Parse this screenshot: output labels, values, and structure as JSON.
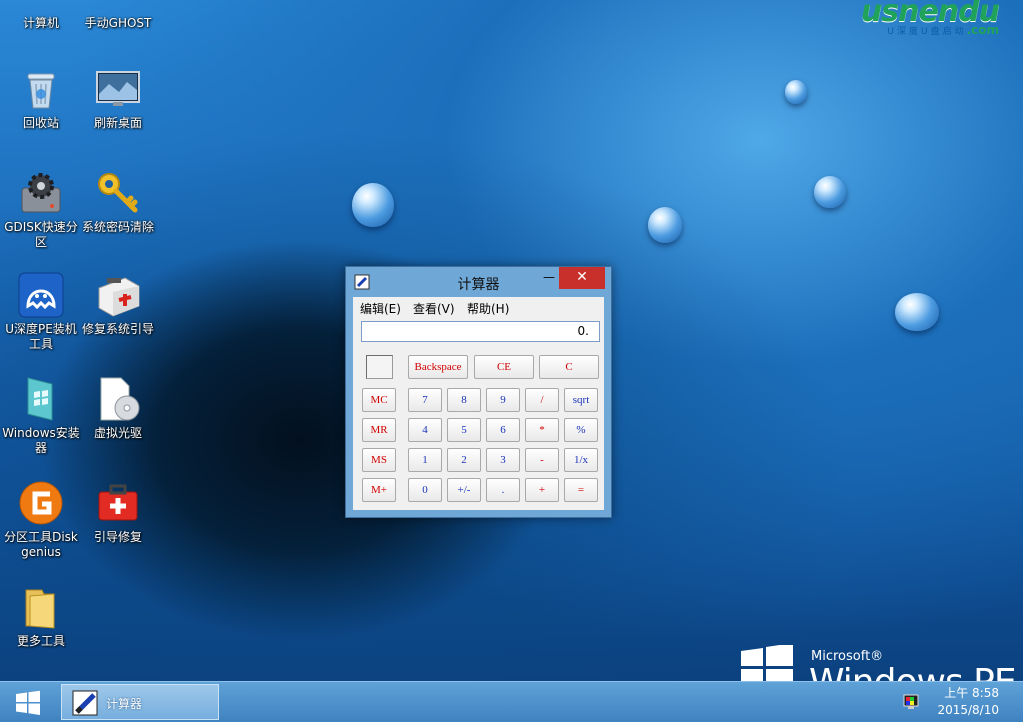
{
  "brand": {
    "main": "usnendu",
    "sub_pre": "U深度U盘启动",
    "sub_dot": ".com"
  },
  "desktop_icons": [
    {
      "label": "计算机"
    },
    {
      "label": "手动GHOST"
    },
    {
      "label": "回收站"
    },
    {
      "label": "刷新桌面"
    },
    {
      "label": "GDISK快速分区"
    },
    {
      "label": "系统密码清除"
    },
    {
      "label": "U深度PE装机工具"
    },
    {
      "label": "修复系统引导"
    },
    {
      "label": "Windows安装器"
    },
    {
      "label": "虚拟光驱"
    },
    {
      "label": "分区工具Diskgenius"
    },
    {
      "label": "引导修复"
    },
    {
      "label": "更多工具"
    }
  ],
  "calculator": {
    "title": "计算器",
    "menu": {
      "edit": "编辑(E)",
      "view": "查看(V)",
      "help": "帮助(H)"
    },
    "display": "0.",
    "controls": {
      "minimize": "—",
      "close": "✕"
    },
    "keys": {
      "backspace": "Backspace",
      "ce": "CE",
      "c": "C",
      "mc": "MC",
      "mr": "MR",
      "ms": "MS",
      "mplus": "M+",
      "k7": "7",
      "k8": "8",
      "k9": "9",
      "div": "/",
      "sqrt": "sqrt",
      "k4": "4",
      "k5": "5",
      "k6": "6",
      "mul": "*",
      "pct": "%",
      "k1": "1",
      "k2": "2",
      "k3": "3",
      "sub": "-",
      "inv": "1/x",
      "k0": "0",
      "neg": "+/-",
      "dot": ".",
      "add": "+",
      "eq": "="
    }
  },
  "taskbar": {
    "task_label": "计算器",
    "clock_time": "上午 8:58",
    "clock_date": "2015/8/10"
  },
  "watermark": {
    "microsoft": "Microsoft®",
    "product": "Windows PE"
  },
  "colors": {
    "accent": "#3f82c0",
    "close": "#c7302b",
    "key_red": "#d00000",
    "key_blue": "#1c34b8"
  }
}
